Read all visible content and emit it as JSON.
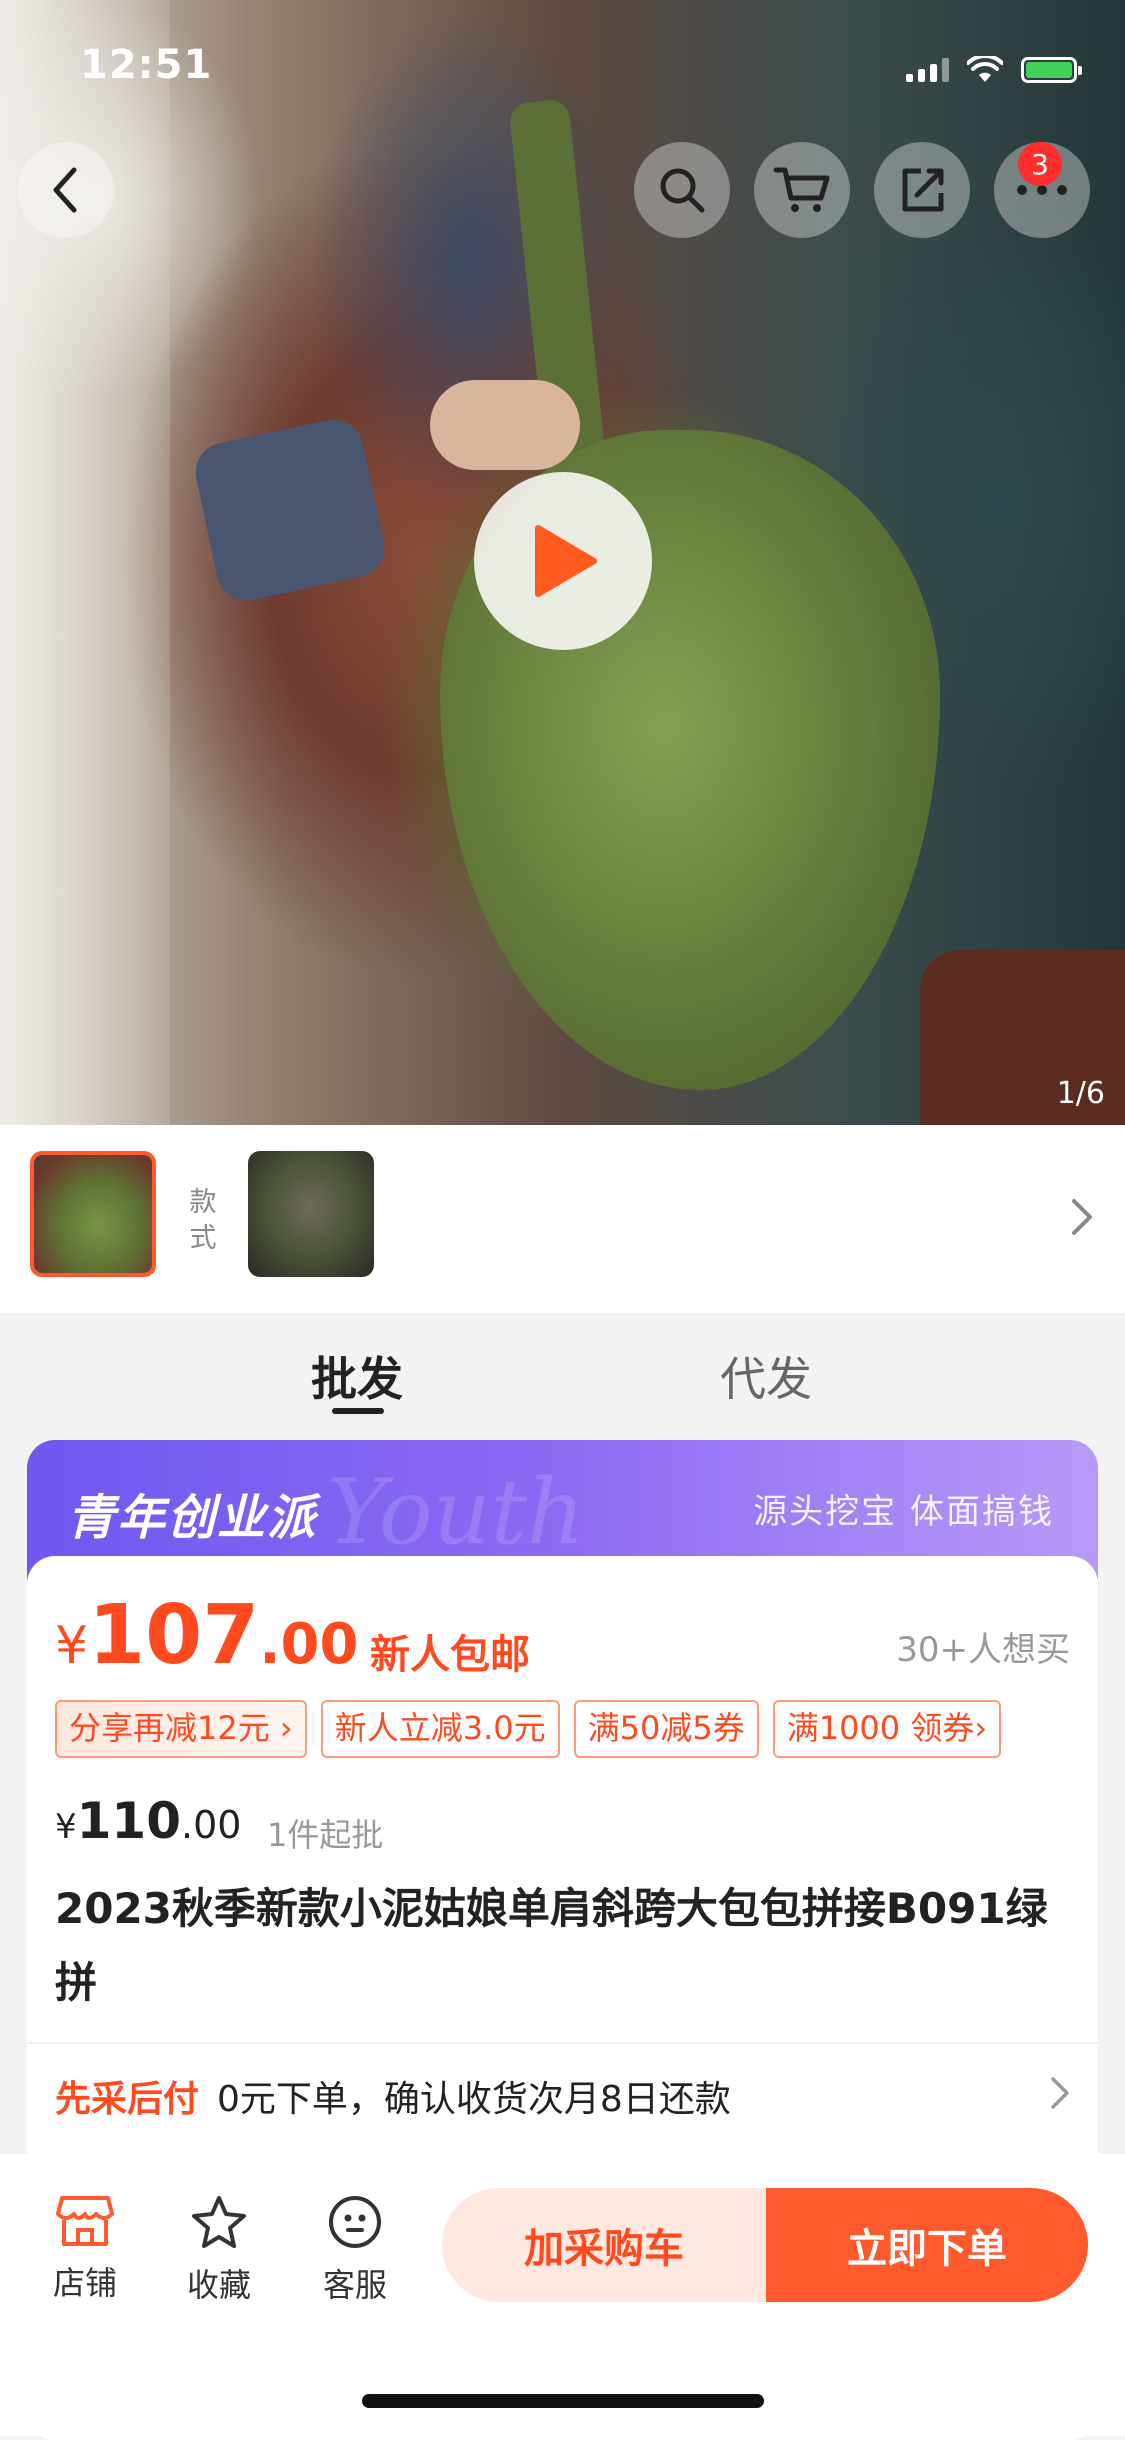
{
  "status": {
    "time": "12:51"
  },
  "header": {
    "cart_badge": "3"
  },
  "media": {
    "counter": "1/6"
  },
  "styles": {
    "label": "款式"
  },
  "tabs": [
    {
      "label": "批发",
      "active": true
    },
    {
      "label": "代发",
      "active": false
    }
  ],
  "promo": {
    "logo": "青年创业派",
    "watermark": "Youth",
    "slogan": "源头挖宝  体面搞钱"
  },
  "price": {
    "currency": "¥",
    "integer": "107",
    "decimal": ".00",
    "free_shipping": "新人包邮",
    "wants": "30+人想买"
  },
  "coupons": [
    "分享再减12元 ›",
    "新人立减3.0元",
    "满50减5券",
    "满1000 领券›"
  ],
  "original": {
    "currency": "¥",
    "integer": "110",
    "decimal": ".00",
    "min_qty": "1件起批"
  },
  "title": "2023秋季新款小泥姑娘单肩斜跨大包包拼接B091绿拼",
  "pay_later": {
    "label": "先采后付",
    "text": "0元下单，确认收货次月8日还款"
  },
  "bottom": {
    "shop": "店铺",
    "favorite": "收藏",
    "service": "客服",
    "add_cart": "加采购车",
    "buy_now": "立即下单"
  },
  "colors": {
    "accent": "#ff5a2e",
    "promo_start": "#6f58f0",
    "promo_end": "#b79af7"
  }
}
